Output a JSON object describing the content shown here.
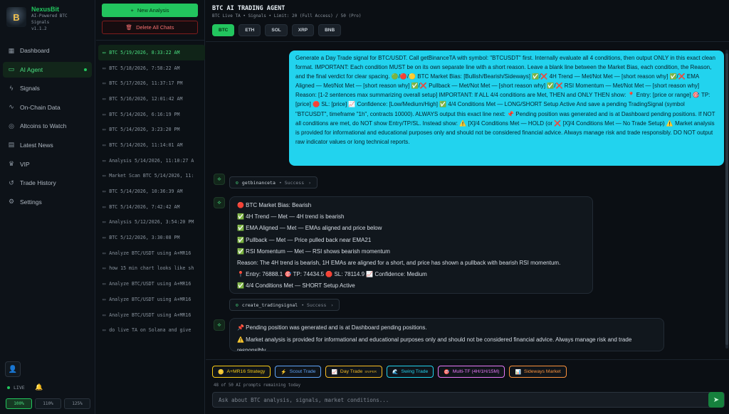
{
  "brand": {
    "name": "NexusBit",
    "tagline_1": "AI-Powered BTC",
    "tagline_2": "Signals",
    "version": "v1.1.2",
    "logo_letter": "B"
  },
  "nav": [
    {
      "label": "Dashboard",
      "icon": "grid-icon",
      "glyph": "▦",
      "active": false
    },
    {
      "label": "AI Agent",
      "icon": "chat-icon",
      "glyph": "▭",
      "active": true
    },
    {
      "label": "Signals",
      "icon": "pulse-icon",
      "glyph": "ϟ",
      "active": false
    },
    {
      "label": "On-Chain Data",
      "icon": "activity-icon",
      "glyph": "∿",
      "active": false
    },
    {
      "label": "Altcoins to Watch",
      "icon": "coins-icon",
      "glyph": "◎",
      "active": false
    },
    {
      "label": "Latest News",
      "icon": "newspaper-icon",
      "glyph": "▤",
      "active": false
    },
    {
      "label": "VIP",
      "icon": "crown-icon",
      "glyph": "♛",
      "active": false
    },
    {
      "label": "Trade History",
      "icon": "history-icon",
      "glyph": "↺",
      "active": false
    },
    {
      "label": "Settings",
      "icon": "gear-icon",
      "glyph": "⚙",
      "active": false
    }
  ],
  "status": {
    "live": "LIVE"
  },
  "zoom": {
    "options": [
      "100%",
      "110%",
      "125%"
    ],
    "selected": "100%"
  },
  "actions": {
    "new_analysis": "New Analysis",
    "delete_all": "Delete All Chats"
  },
  "chats": [
    "BTC 5/19/2026, 8:33:22 AM",
    "BTC 5/18/2026, 7:58:22 AM",
    "BTC 5/17/2026, 11:37:17 PM",
    "BTC 5/16/2026, 12:01:42 AM",
    "BTC 5/14/2026, 6:16:19 PM",
    "BTC 5/14/2026, 3:23:20 PM",
    "BTC 5/14/2026, 11:14:01 AM",
    "Analysis 5/14/2026, 11:10:27 A",
    "Market Scan BTC 5/14/2026, 11:",
    "BTC 5/14/2026, 10:36:39 AM",
    "BTC 5/14/2026, 7:42:42 AM",
    "Analysis 5/12/2026, 3:54:20 PM",
    "BTC 5/12/2026, 3:30:08 PM",
    "Analyze BTC/USDT using A+MR16",
    "how 15 min chart looks like sh",
    "Analyze BTC/USDT using A+MR16",
    "Analyze BTC/USDT using A+MR16",
    "Analyze BTC/USDT using A+MR16",
    "do live TA on Solana and give"
  ],
  "header": {
    "title": "BTC AI TRADING AGENT",
    "subtitle": "BTC Live TA • Signals • Limit: 20 (Full Access) / 50 (Pro)"
  },
  "coins": [
    {
      "label": "BTC",
      "active": true
    },
    {
      "label": "ETH",
      "active": false
    },
    {
      "label": "SOL",
      "active": false
    },
    {
      "label": "XRP",
      "active": false
    },
    {
      "label": "BNB",
      "active": false
    }
  ],
  "user_message": "Generate a Day Trade signal for BTC/USDT. Call getBinanceTA with symbol: \"BTCUSDT\" first. Internally evaluate all 4 conditions, then output ONLY in this exact clean format. IMPORTANT: Each condition MUST be on its own separate line with a short reason. Leave a blank line between the Market Bias, each condition, the Reason, and the final verdict for clear spacing. 🟢/🔴/🟡 BTC Market Bias: [Bullish/Bearish/Sideways] ✅/❌ 4H Trend — Met/Not Met — [short reason why] ✅/❌ EMA Aligned — Met/Not Met — [short reason why] ✅/❌ Pullback — Met/Not Met — [short reason why] ✅/❌ RSI Momentum — Met/Not Met — [short reason why] Reason: [1-2 sentences max summarizing overall setup] IMPORTANT: If ALL 4/4 conditions are Met, THEN and ONLY THEN show: 📍 Entry: [price or range] 🎯 TP: [price] 🛑 SL: [price] 📈 Confidence: [Low/Medium/High] ✅ 4/4 Conditions Met — LONG/SHORT Setup Active And save a pending TradingSignal (symbol \"BTCUSDT\", timeframe \"1h\", contracts 10000). ALWAYS output this exact line next: 📌 Pending position was generated and is at Dashboard pending positions. If NOT all conditions are met, do NOT show Entry/TP/SL. Instead show: ⚠️ [X]/4 Conditions Met — HOLD (or ❌ [X]/4 Conditions Met — No Trade Setup) ⚠️ Market analysis is provided for informational and educational purposes only and should not be considered financial advice. Always manage risk and trade responsibly. DO NOT output raw indicator values or long technical reports.",
  "tool_calls": [
    {
      "name": "getbinanceta",
      "status": "Success"
    },
    {
      "name": "create_tradingsignal",
      "status": "Success"
    }
  ],
  "bot_response_lines": [
    "🔴 BTC Market Bias: Bearish",
    "✅ 4H Trend — Met — 4H trend is bearish",
    "✅ EMA Aligned — Met — EMAs aligned and price below",
    "✅ Pullback — Met — Price pulled back near EMA21",
    "✅ RSI Momentum — Met — RSI shows bearish momentum",
    "Reason: The 4H trend is bearish, 1H EMAs are aligned for a short, and price has shown a pullback with bearish RSI momentum.",
    "📍 Entry: 76888.1 🎯 TP: 74434.5 🛑 SL: 78114.9 📈 Confidence: Medium",
    "✅ 4/4 Conditions Met — SHORT Setup Active"
  ],
  "bot_followup_lines": [
    "📌 Pending position was generated and is at Dashboard pending positions.",
    "⚠️ Market analysis is provided for informational and educational purposes only and should not be considered financial advice. Always manage risk and trade responsibly."
  ],
  "chips": [
    {
      "icon": "🪙",
      "label": "A+MR16 Strategy",
      "tag": "",
      "color": "#facc15"
    },
    {
      "icon": "⚡",
      "label": "Scout Trade",
      "tag": "",
      "color": "#60a5fa"
    },
    {
      "icon": "📈",
      "label": "Day Trade",
      "tag": "SNIPER",
      "color": "#fbbf24"
    },
    {
      "icon": "🌊",
      "label": "Swing Trade",
      "tag": "",
      "color": "#22d3ee"
    },
    {
      "icon": "🎯",
      "label": "Multi-TF (4H/1H/15M)",
      "tag": "",
      "color": "#e879f9"
    },
    {
      "icon": "📊",
      "label": "Sideways Market",
      "tag": "",
      "color": "#fb923c"
    }
  ],
  "remaining": "48 of 50 AI prompts remaining today",
  "input": {
    "placeholder": "Ask about BTC analysis, signals, market conditions...",
    "value": ""
  }
}
